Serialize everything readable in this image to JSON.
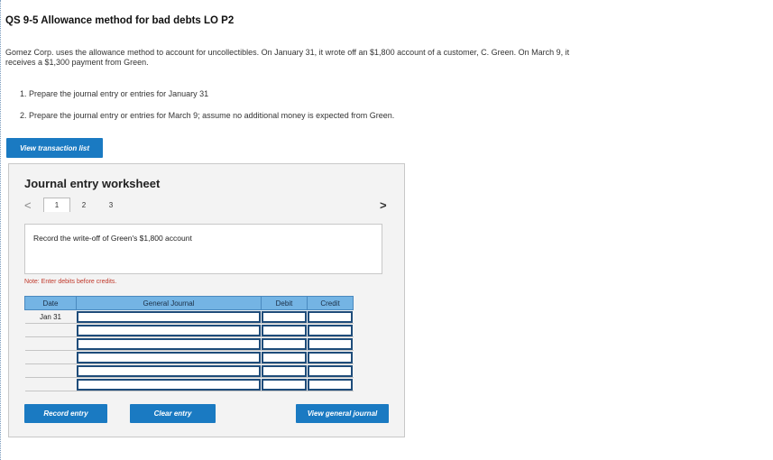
{
  "question": {
    "title": "QS 9-5 Allowance method for bad debts LO P2",
    "text": "Gomez Corp. uses the allowance method to account for uncollectibles. On January 31, it wrote off an $1,800 account of a customer, C. Green. On March 9, it receives a $1,300 payment from Green.",
    "req1": "1. Prepare the journal entry or entries for January 31",
    "req2": "2. Prepare the journal entry or entries for March 9; assume no additional money is expected from Green."
  },
  "buttons": {
    "view_transaction_list": "View transaction list",
    "record_entry": "Record entry",
    "clear_entry": "Clear entry",
    "view_general_journal": "View general journal"
  },
  "worksheet": {
    "title": "Journal entry worksheet",
    "prev_icon": "<",
    "next_icon": ">",
    "tabs": [
      "1",
      "2",
      "3"
    ],
    "description": "Record the write-off of Green's $1,800 account",
    "note": "Note: Enter debits before credits.",
    "headers": {
      "date": "Date",
      "general_journal": "General Journal",
      "debit": "Debit",
      "credit": "Credit"
    },
    "rows": [
      {
        "date": "Jan 31"
      },
      {
        "date": ""
      },
      {
        "date": ""
      },
      {
        "date": ""
      },
      {
        "date": ""
      },
      {
        "date": ""
      }
    ]
  }
}
